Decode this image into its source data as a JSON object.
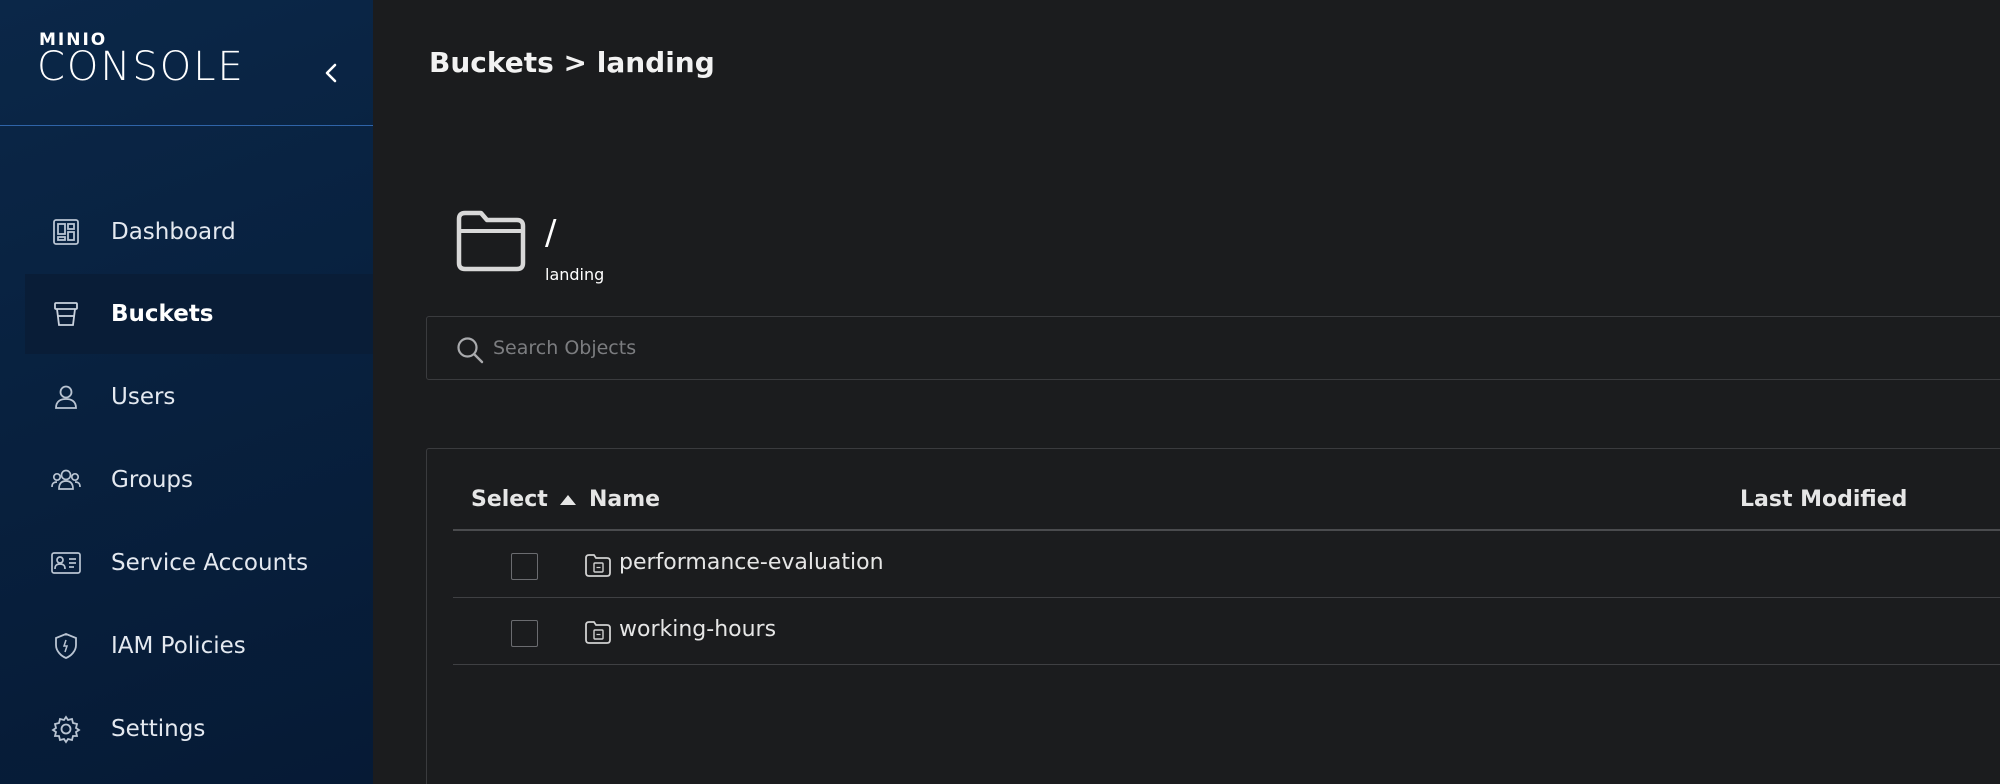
{
  "logo": {
    "brand": "MINIO",
    "product": "CONSOLE"
  },
  "sidebar": {
    "items": [
      {
        "label": "Dashboard",
        "icon": "dashboard-icon"
      },
      {
        "label": "Buckets",
        "icon": "bucket-icon",
        "active": true
      },
      {
        "label": "Users",
        "icon": "user-icon"
      },
      {
        "label": "Groups",
        "icon": "groups-icon"
      },
      {
        "label": "Service Accounts",
        "icon": "service-accounts-icon"
      },
      {
        "label": "IAM Policies",
        "icon": "shield-icon"
      },
      {
        "label": "Settings",
        "icon": "gear-icon"
      }
    ]
  },
  "header": {
    "breadcrumb": "Buckets > landing"
  },
  "folder": {
    "path": "/",
    "bucket": "landing"
  },
  "search": {
    "placeholder": "Search Objects",
    "value": ""
  },
  "table": {
    "columns": {
      "select": "Select",
      "name": "Name",
      "last_modified": "Last Modified"
    },
    "sort": {
      "column": "Name",
      "direction": "ascending"
    },
    "rows": [
      {
        "name": "performance-evaluation",
        "type": "folder",
        "selected": false
      },
      {
        "name": "working-hours",
        "type": "folder",
        "selected": false
      }
    ]
  },
  "colors": {
    "sidebar_bg": "#0b2748",
    "main_bg": "#1b1c1e",
    "accent": "#2f64a8",
    "text": "#e8e8e8"
  }
}
